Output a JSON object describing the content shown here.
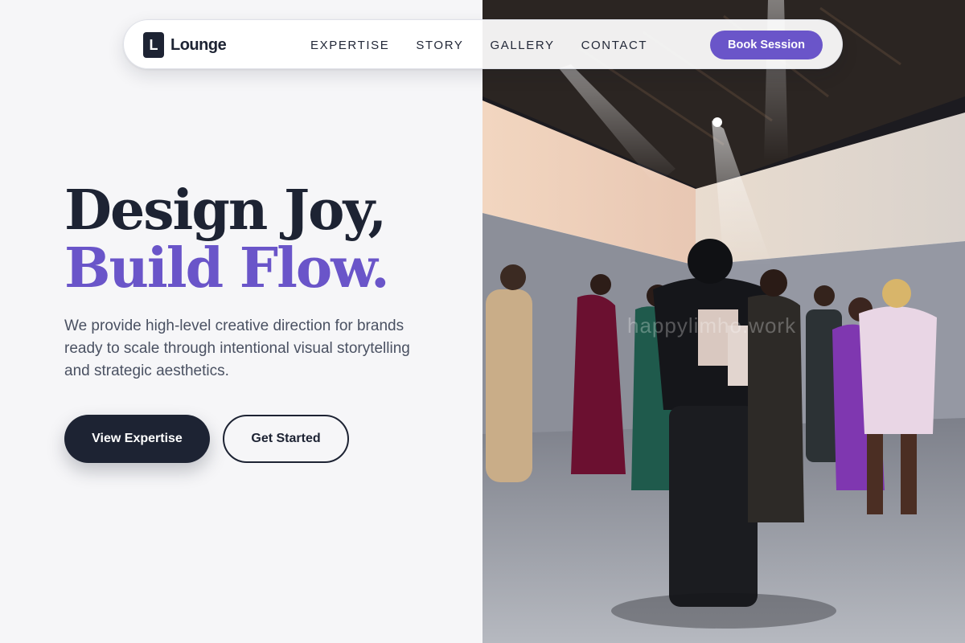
{
  "nav": {
    "brand_mark": "L",
    "brand_name": "Lounge",
    "links": [
      "EXPERTISE",
      "STORY",
      "GALLERY",
      "CONTACT"
    ],
    "cta_label": "Book Session"
  },
  "hero": {
    "title_line1": "Design Joy,",
    "title_line2": "Build Flow.",
    "description": "We provide high-level creative direction for brands ready to scale through intentional visual storytelling and strategic aesthetics.",
    "primary_button": "View Expertise",
    "secondary_button": "Get Started",
    "image_watermark": "happylimho.work"
  },
  "colors": {
    "accent": "#6a55c9",
    "dark": "#1d2333",
    "background": "#f6f6f8"
  }
}
